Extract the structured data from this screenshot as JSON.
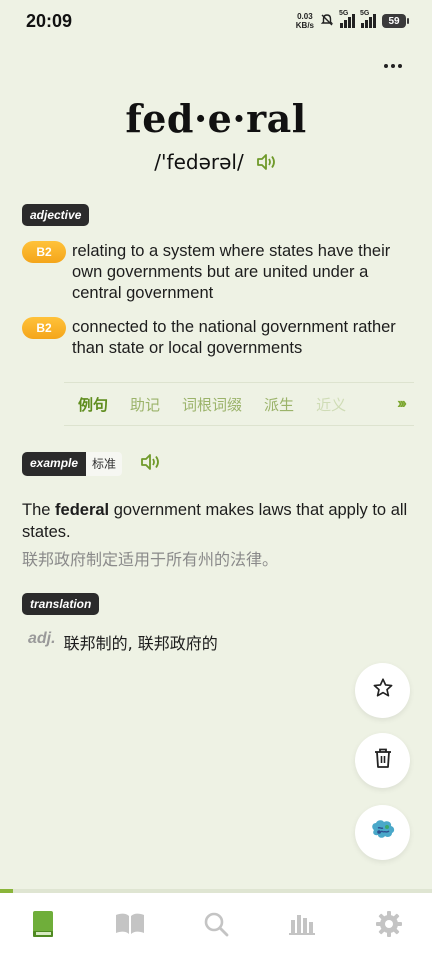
{
  "status_bar": {
    "time": "20:09",
    "net_speed_value": "0.03",
    "net_speed_unit": "KB/s",
    "sim1": "5G",
    "sim2": "5G",
    "battery": "59"
  },
  "word": {
    "headword": "fed·e·ral",
    "pronunciation": "/'fedərəl/"
  },
  "part_of_speech": "adjective",
  "senses": [
    {
      "level": "B2",
      "text": "relating to a system where states have their own governments but are united under a central government"
    },
    {
      "level": "B2",
      "text": "connected to the national government rather than state or local governments"
    }
  ],
  "tabs": [
    {
      "label": "例句",
      "active": true
    },
    {
      "label": "助记",
      "active": false
    },
    {
      "label": "词根词缀",
      "active": false
    },
    {
      "label": "派生",
      "active": false
    },
    {
      "label": "近义",
      "active": false
    }
  ],
  "example": {
    "tag": "example",
    "standard_label": "标准",
    "sentence_before": "The ",
    "sentence_bold": "federal",
    "sentence_after": " government makes laws that apply to all states.",
    "translation": "联邦政府制定适用于所有州的法律。"
  },
  "translation": {
    "tag": "translation",
    "pos": "adj.",
    "value": "联邦制的, 联邦政府的"
  },
  "colors": {
    "accent": "#6f9a2a",
    "level_badge": "#f4a51a",
    "background": "#eef2e4",
    "tag_bg": "#2b2b2b"
  },
  "icons": {
    "fab_star": "star-icon",
    "fab_trash": "trash-icon",
    "fab_brain": "brain-icon",
    "nav": [
      "book-icon",
      "open-book-icon",
      "search-icon",
      "stats-icon",
      "gear-icon"
    ]
  },
  "progress": 0.03
}
